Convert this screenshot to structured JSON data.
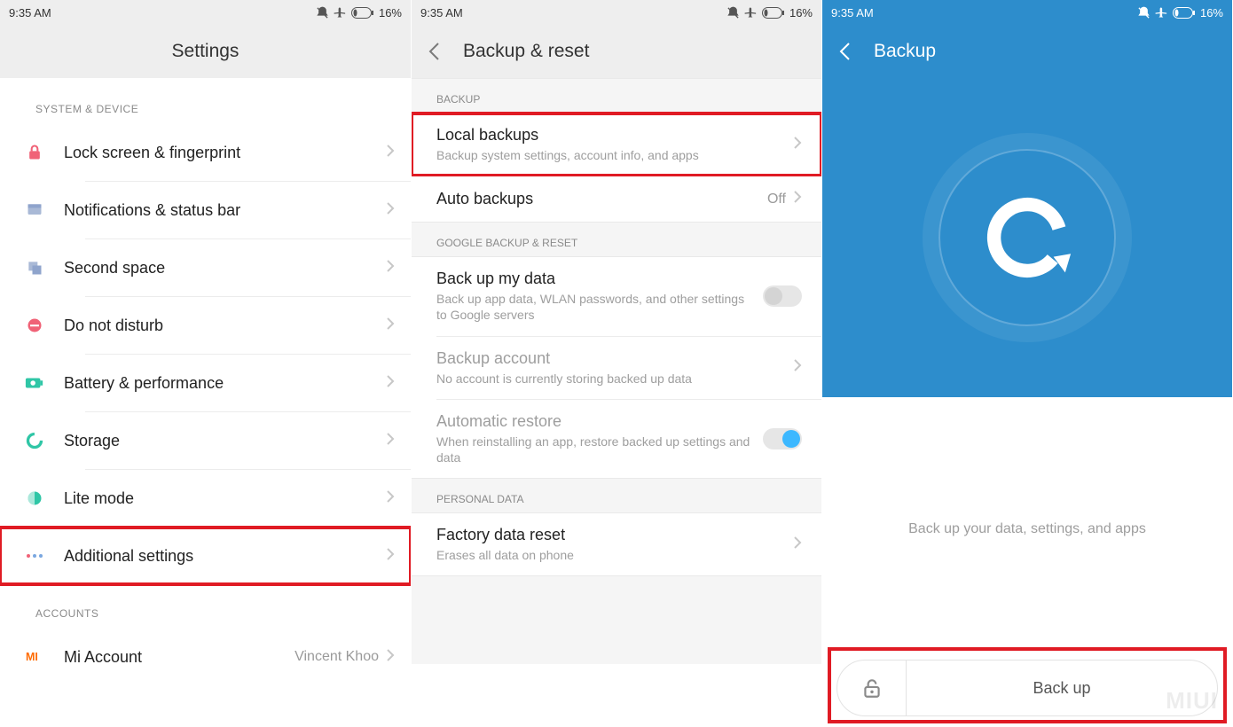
{
  "status": {
    "time": "9:35 AM",
    "battery": "16%"
  },
  "screen1": {
    "title": "Settings",
    "sections": [
      {
        "header": "SYSTEM & DEVICE",
        "items": [
          {
            "key": "lock",
            "icon": "lock-icon",
            "label": "Lock screen & fingerprint"
          },
          {
            "key": "notif",
            "icon": "notification-icon",
            "label": "Notifications & status bar"
          },
          {
            "key": "second",
            "icon": "second-space-icon",
            "label": "Second space"
          },
          {
            "key": "dnd",
            "icon": "dnd-icon",
            "label": "Do not disturb"
          },
          {
            "key": "battery",
            "icon": "battery-icon",
            "label": "Battery & performance"
          },
          {
            "key": "storage",
            "icon": "storage-icon",
            "label": "Storage"
          },
          {
            "key": "lite",
            "icon": "lite-mode-icon",
            "label": "Lite mode"
          },
          {
            "key": "addl",
            "icon": "more-icon",
            "label": "Additional settings",
            "highlight": true
          }
        ]
      },
      {
        "header": "ACCOUNTS",
        "items": [
          {
            "key": "mi",
            "icon": "mi-icon",
            "label": "Mi Account",
            "value": "Vincent Khoo"
          }
        ]
      }
    ]
  },
  "screen2": {
    "title": "Backup & reset",
    "groups": [
      {
        "header": "BACKUP",
        "rows": [
          {
            "key": "local",
            "title": "Local backups",
            "sub": "Backup system settings, account info, and apps",
            "highlight": true,
            "chev": true
          },
          {
            "key": "auto",
            "title": "Auto backups",
            "value": "Off",
            "chev": true
          }
        ]
      },
      {
        "header": "GOOGLE BACKUP & RESET",
        "rows": [
          {
            "key": "gback",
            "title": "Back up my data",
            "sub": "Back up app data, WLAN passwords, and other settings to Google servers",
            "toggle": "off"
          },
          {
            "key": "bacct",
            "title": "Backup account",
            "sub": "No account is currently storing backed up data",
            "disabled": true,
            "chev": true
          },
          {
            "key": "autorest",
            "title": "Automatic restore",
            "sub": "When reinstalling an app, restore backed up settings and data",
            "disabled": true,
            "toggle": "on"
          }
        ]
      },
      {
        "header": "PERSONAL DATA",
        "rows": [
          {
            "key": "factory",
            "title": "Factory data reset",
            "sub": "Erases all data on phone",
            "chev": true
          }
        ]
      }
    ]
  },
  "screen3": {
    "title": "Backup",
    "body_text": "Back up your data, settings, and apps",
    "button_label": "Back up",
    "highlight_button": true
  },
  "watermark": "MIUI"
}
